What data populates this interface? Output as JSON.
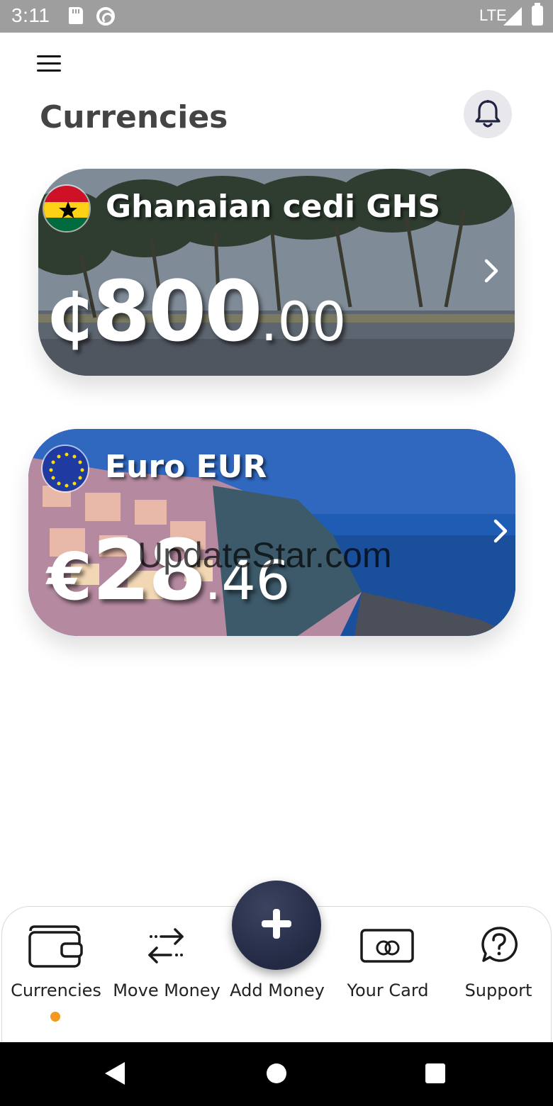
{
  "status_bar": {
    "time": "3:11",
    "network": "LTE",
    "icons": [
      "sd-card-icon",
      "sync-icon",
      "signal-icon",
      "battery-icon"
    ]
  },
  "header": {
    "title": "Currencies",
    "menu_icon": "hamburger-menu-icon",
    "notification_icon": "bell-icon"
  },
  "cards": [
    {
      "name": "Ghanaian cedi GHS",
      "symbol": "₵",
      "amount_int": "800",
      "amount_dec": ".00",
      "flag": "ghana-flag-icon"
    },
    {
      "name": "Euro EUR",
      "symbol": "€",
      "amount_int": "28",
      "amount_dec": ".46",
      "flag": "eu-flag-icon"
    }
  ],
  "watermark": "UpdateStar.com",
  "bottom_nav": {
    "items": [
      {
        "label": "Currencies",
        "icon": "wallet-icon",
        "active": true
      },
      {
        "label": "Move Money",
        "icon": "transfer-arrows-icon",
        "active": false
      },
      {
        "label": "Add Money",
        "icon": "plus-icon",
        "active": false
      },
      {
        "label": "Your Card",
        "icon": "card-icon",
        "active": false
      },
      {
        "label": "Support",
        "icon": "help-bubble-icon",
        "active": false
      }
    ]
  },
  "colors": {
    "active_indicator": "#f39a1e",
    "fab_background": "#232a44",
    "status_bar": "#9e9e9e"
  }
}
